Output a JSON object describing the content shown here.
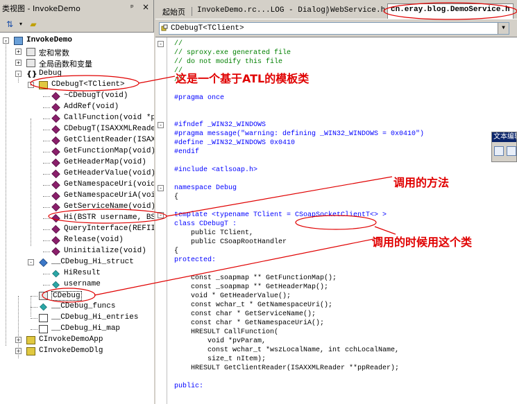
{
  "left_panel": {
    "title": "类视图 - InvokeDemo",
    "pin_icon": "pin-icon",
    "close_icon": "close-icon",
    "toolbar": [
      "sort-icon",
      "new-folder-icon"
    ],
    "tree": [
      {
        "label": "InvokeDemo",
        "icon": "project-icon",
        "expand": "-",
        "bold": true
      },
      {
        "label": "宏和常数",
        "icon": "macros-icon",
        "expand": "+",
        "cn": true
      },
      {
        "label": "全局函数和变量",
        "icon": "globals-icon",
        "expand": "+",
        "cn": true
      },
      {
        "label": "Debug",
        "icon": "namespace-icon",
        "expand": "-"
      },
      {
        "label": "CDebugT<TClient>",
        "icon": "class-template-icon",
        "expand": "-"
      },
      {
        "label": "~CDebugT(void)",
        "icon": "method-icon"
      },
      {
        "label": "AddRef(void)",
        "icon": "method-icon"
      },
      {
        "label": "CallFunction(void *p",
        "icon": "method-icon"
      },
      {
        "label": "CDebugT(ISAXXMLReade",
        "icon": "method-icon"
      },
      {
        "label": "GetClientReader(ISAX",
        "icon": "method-icon"
      },
      {
        "label": "GetFunctionMap(void)",
        "icon": "method-icon"
      },
      {
        "label": "GetHeaderMap(void)",
        "icon": "method-icon"
      },
      {
        "label": "GetHeaderValue(void)",
        "icon": "method-icon"
      },
      {
        "label": "GetNamespaceUri(void",
        "icon": "method-icon"
      },
      {
        "label": "GetNamespaceUriA(voi",
        "icon": "method-icon"
      },
      {
        "label": "GetServiceName(void)",
        "icon": "method-icon"
      },
      {
        "label": "Hi(BSTR username, BS",
        "icon": "method-icon"
      },
      {
        "label": "QueryInterface(REFII",
        "icon": "method-icon"
      },
      {
        "label": "Release(void)",
        "icon": "method-icon"
      },
      {
        "label": "Uninitialize(void)",
        "icon": "method-icon"
      },
      {
        "label": "__CDebug_Hi_struct",
        "icon": "struct-icon",
        "expand": "-"
      },
      {
        "label": "HiResult",
        "icon": "field-icon"
      },
      {
        "label": "username",
        "icon": "field-icon"
      },
      {
        "label": "CDebug",
        "icon": "typedef-icon",
        "boxed": true
      },
      {
        "label": "__CDebug_funcs",
        "icon": "field-icon"
      },
      {
        "label": "__CDebug_Hi_entries",
        "icon": "enum-icon"
      },
      {
        "label": "__CDebug_Hi_map",
        "icon": "enum-icon"
      },
      {
        "label": "CInvokeDemoApp",
        "icon": "class-icon",
        "expand": "+"
      },
      {
        "label": "CInvokeDemoDlg",
        "icon": "class-icon",
        "expand": "+"
      }
    ]
  },
  "editor": {
    "tabs": [
      {
        "label": "起始页",
        "cn": true
      },
      {
        "label": "InvokeDemo.rc...LOG - Dialog)"
      },
      {
        "label": "WebService.h"
      },
      {
        "label": "cn.eray.blog.DemoService.h",
        "active": true
      }
    ],
    "scope": "CDebugT<TClient>",
    "code": [
      {
        "text": "//",
        "cls": "c-cmt"
      },
      {
        "text": "// sproxy.exe generated file",
        "cls": "c-cmt"
      },
      {
        "text": "// do not modify this file",
        "cls": "c-cmt"
      },
      {
        "text": "//",
        "cls": "c-cmt"
      },
      {
        "text": "//",
        "cls": "c-cmt"
      },
      {
        "text": ""
      },
      {
        "text": "#pragma once",
        "cls": "c-kw"
      },
      {
        "text": ""
      },
      {
        "text": ""
      },
      {
        "text": "#ifndef _WIN32_WINDOWS",
        "cls": "c-kw"
      },
      {
        "text": "#pragma message(\"warning: defining _WIN32_WINDOWS = 0x0410\")",
        "cls": "c-kw"
      },
      {
        "text": "#define _WIN32_WINDOWS 0x0410",
        "cls": "c-kw"
      },
      {
        "text": "#endif",
        "cls": "c-kw"
      },
      {
        "text": ""
      },
      {
        "text": "#include <atlsoap.h>",
        "cls": "c-kw"
      },
      {
        "text": ""
      },
      {
        "text": "namespace Debug",
        "cls": "c-kw"
      },
      {
        "text": "{"
      },
      {
        "text": ""
      },
      {
        "text": "template <typename TClient = CSoapSocketClientT<> >",
        "cls": "c-kw"
      },
      {
        "text": "class CDebugT :",
        "cls": "c-kw"
      },
      {
        "text": "    public TClient,"
      },
      {
        "text": "    public CSoapRootHandler"
      },
      {
        "text": "{"
      },
      {
        "text": "protected:",
        "cls": "c-kw"
      },
      {
        "text": ""
      },
      {
        "text": "    const _soapmap ** GetFunctionMap();"
      },
      {
        "text": "    const _soapmap ** GetHeaderMap();"
      },
      {
        "text": "    void * GetHeaderValue();"
      },
      {
        "text": "    const wchar_t * GetNamespaceUri();"
      },
      {
        "text": "    const char * GetServiceName();"
      },
      {
        "text": "    const char * GetNamespaceUriA();"
      },
      {
        "text": "    HRESULT CallFunction("
      },
      {
        "text": "        void *pvParam,"
      },
      {
        "text": "        const wchar_t *wszLocalName, int cchLocalName,"
      },
      {
        "text": "        size_t nItem);"
      },
      {
        "text": "    HRESULT GetClientReader(ISAXXMLReader **ppReader);"
      },
      {
        "text": ""
      },
      {
        "text": "public:",
        "cls": "c-kw"
      }
    ]
  },
  "text_toolbar": {
    "title": "文本编辑器",
    "buttons": [
      "comment-icon",
      "uncomment-icon"
    ]
  },
  "annotations": {
    "atl_template": "这是一个基于ATL的模板类",
    "called_method": "调用的方法",
    "call_class": "调用的时候用这个类"
  },
  "colors": {
    "annotation": "#e00000",
    "comment": "#008000",
    "keyword": "#0000ff"
  }
}
